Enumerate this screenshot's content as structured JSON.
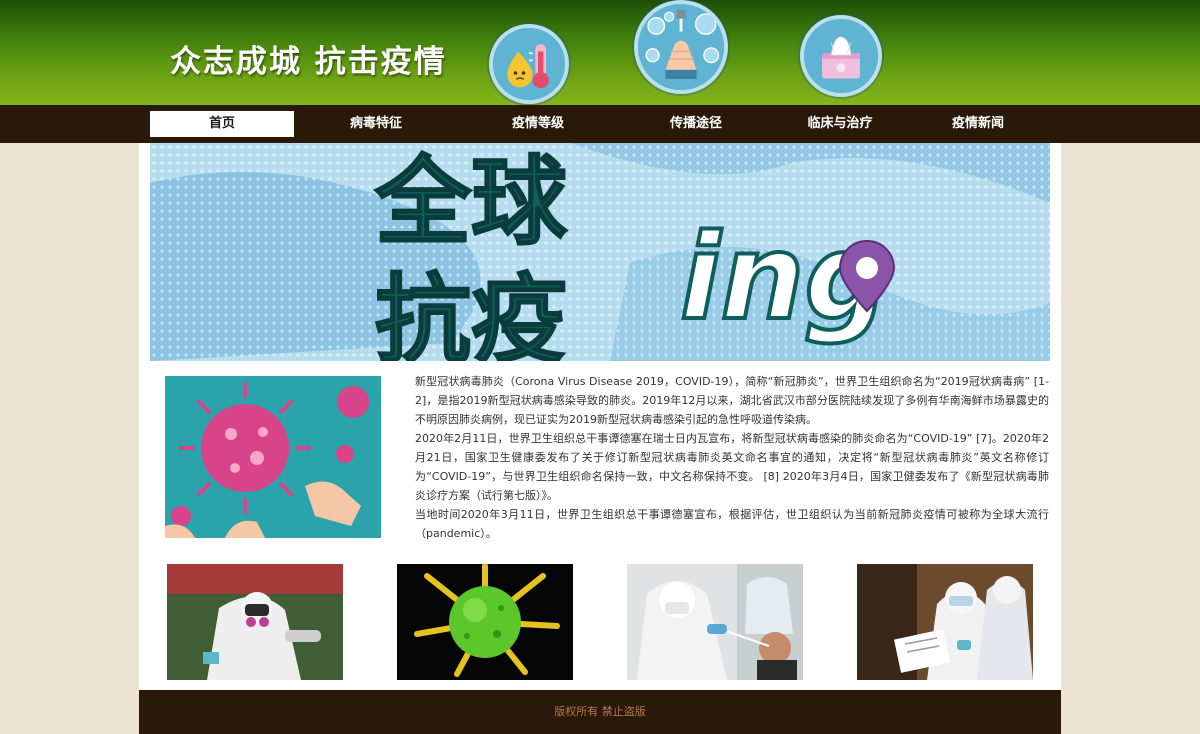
{
  "header": {
    "title": "众志成城 抗击疫情",
    "badges": [
      "thermometer-droplet-icon",
      "hand-washing-icon",
      "tissue-box-icon"
    ]
  },
  "nav": {
    "items": [
      {
        "label": "首页",
        "active": true
      },
      {
        "label": "病毒特征",
        "active": false
      },
      {
        "label": "疫情等级",
        "active": false
      },
      {
        "label": "传播途径",
        "active": false
      },
      {
        "label": "临床与治疗",
        "active": false
      },
      {
        "label": "疫情新闻",
        "active": false
      }
    ]
  },
  "banner": {
    "text_line1": "全球",
    "text_line2": "抗疫",
    "text_suffix": "ing"
  },
  "article": {
    "paragraphs": [
      "新型冠状病毒肺炎（Corona Virus Disease 2019，COVID-19），简称“新冠肺炎”，世界卫生组织命名为“2019冠状病毒病” [1-2]，是指2019新型冠状病毒感染导致的肺炎。2019年12月以来，湖北省武汉市部分医院陆续发现了多例有华南海鲜市场暴露史的不明原因肺炎病例，现已证实为2019新型冠状病毒感染引起的急性呼吸道传染病。",
      "2020年2月11日，世界卫生组织总干事谭德塞在瑞士日内瓦宣布，将新型冠状病毒感染的肺炎命名为“COVID-19” [7]。2020年2月21日，国家卫生健康委发布了关于修订新型冠状病毒肺炎英文命名事宜的通知，决定将“新型冠状病毒肺炎”英文名称修订为“COVID-19”，与世界卫生组织命名保持一致，中文名称保持不变。 [8] 2020年3月4日，国家卫健委发布了《新型冠状病毒肺炎诊疗方案（试行第七版）》。",
      "当地时间2020年3月11日，世界卫生组织总干事谭德塞宣布，根据评估，世卫组织认为当前新冠肺炎疫情可被称为全球大流行（pandemic）。"
    ]
  },
  "footer": {
    "text": "版权所有 禁止盗版"
  },
  "colors": {
    "header_green": "#6fa414",
    "nav_brown": "#2a1908",
    "page_bg": "#ece3d2",
    "footer_text": "#b4784e"
  }
}
